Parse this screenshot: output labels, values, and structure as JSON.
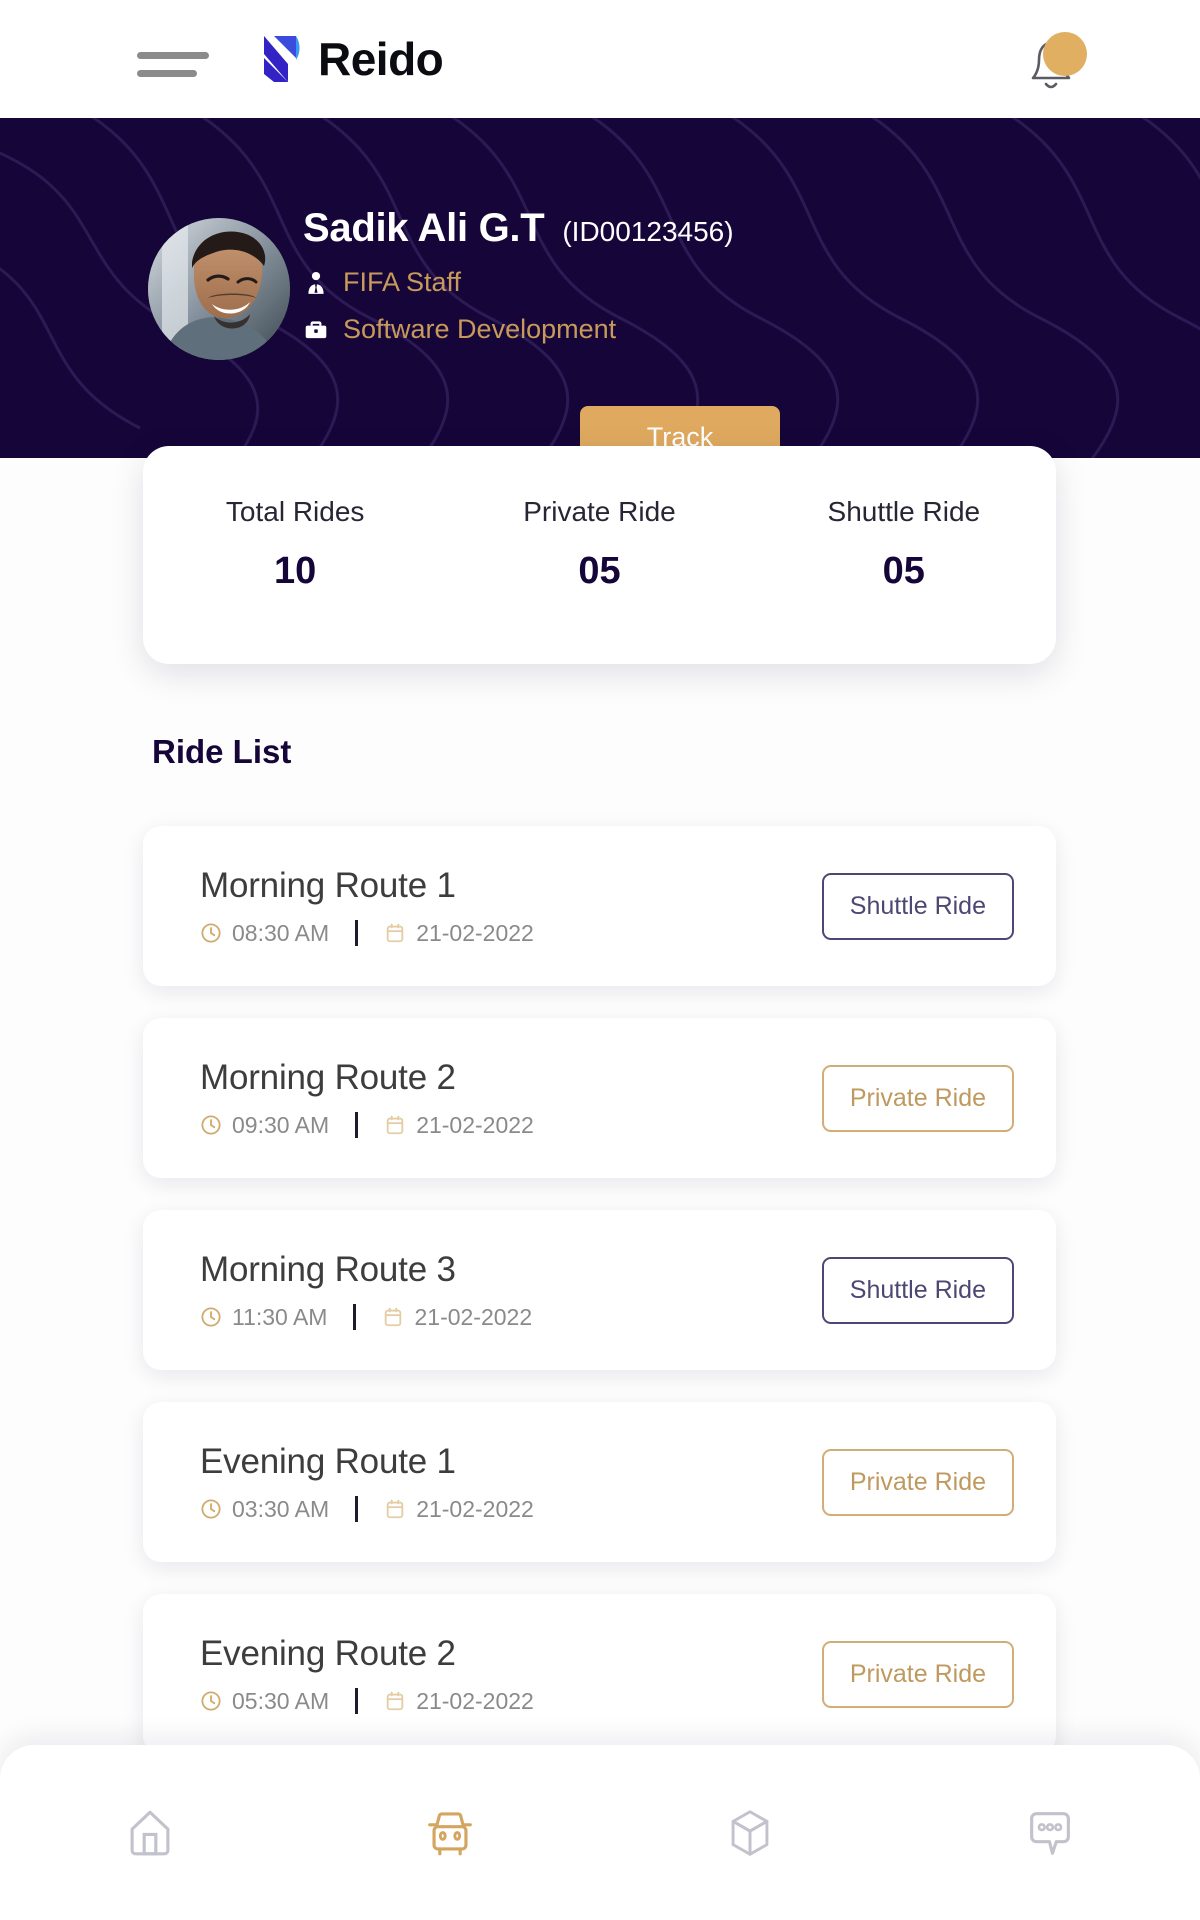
{
  "app": {
    "brand_name": "Reido",
    "brand_logo_icon": "reido-logo-icon",
    "menu_icon": "hamburger-menu-icon",
    "notification_icon": "bell-icon"
  },
  "profile": {
    "name": "Sadik Ali G.T",
    "id": "(ID00123456)",
    "role": "FIFA Staff",
    "role_icon": "person-tie-icon",
    "department": "Software Development",
    "department_icon": "briefcase-icon",
    "avatar_alt": "user-avatar",
    "track_label": "Track",
    "accent_gold": "#dfa95f",
    "banner_color": "#160538"
  },
  "stats": [
    {
      "label": "Total Rides",
      "value": "10"
    },
    {
      "label": "Private Ride",
      "value": "05"
    },
    {
      "label": "Shuttle Ride",
      "value": "05"
    }
  ],
  "ride_list": {
    "title": "Ride List",
    "items": [
      {
        "title": "Morning Route 1",
        "time": "08:30 AM",
        "date": "21-02-2022",
        "badge": "Shuttle Ride",
        "badge_type": "shuttle"
      },
      {
        "title": "Morning Route 2",
        "time": "09:30 AM",
        "date": "21-02-2022",
        "badge": "Private Ride",
        "badge_type": "private"
      },
      {
        "title": "Morning Route 3",
        "time": "11:30 AM",
        "date": "21-02-2022",
        "badge": "Shuttle Ride",
        "badge_type": "shuttle"
      },
      {
        "title": "Evening Route 1",
        "time": "03:30 AM",
        "date": "21-02-2022",
        "badge": "Private Ride",
        "badge_type": "private"
      },
      {
        "title": "Evening Route 2",
        "time": "05:30 AM",
        "date": "21-02-2022",
        "badge": "Private Ride",
        "badge_type": "private"
      }
    ],
    "time_icon": "clock-icon",
    "date_icon": "calendar-icon",
    "shuttle_color": "#4d4873",
    "private_color": "#bf9a5f"
  },
  "bottom_nav": {
    "items": [
      {
        "icon": "home-icon",
        "active": false
      },
      {
        "icon": "car-icon",
        "active": true
      },
      {
        "icon": "box-icon",
        "active": false
      },
      {
        "icon": "chat-icon",
        "active": false
      }
    ],
    "active_color": "#d4a55e",
    "inactive_color": "#c2c2cc"
  }
}
